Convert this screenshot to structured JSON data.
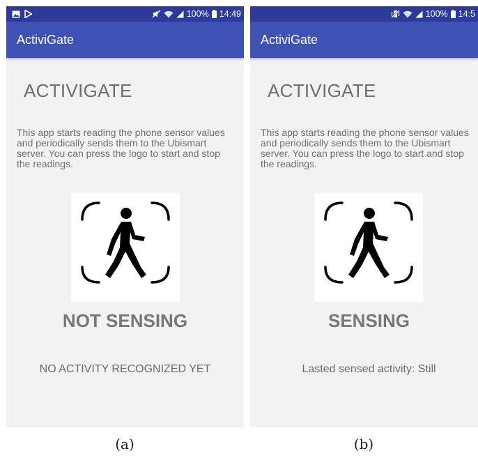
{
  "screens": [
    {
      "status_bar": {
        "left_icons": [
          "image-icon",
          "play-store-icon"
        ],
        "right_icons": [
          "mute-icon",
          "wifi-icon",
          "signal-icon",
          "battery-icon"
        ],
        "battery": "100%",
        "time": "14:49"
      },
      "app_bar": {
        "title": "ActiviGate"
      },
      "heading": "ACTIVIGATE",
      "description": "This app starts reading the phone sensor values and periodically sends them to the Ubismart server. You can press the logo to start and stop the readings.",
      "logo_icon": "walking-person-icon",
      "sensing_status": "NOT SENSING",
      "activity_text": "NO ACTIVITY RECOGNIZED YET"
    },
    {
      "status_bar": {
        "left_icons": [],
        "right_icons": [
          "vibrate-mute-icon",
          "wifi-icon",
          "signal-icon",
          "battery-icon"
        ],
        "battery": "100%",
        "time": "14:5"
      },
      "app_bar": {
        "title": "ActiviGate"
      },
      "heading": "ACTIVIGATE",
      "description": "This app starts reading the phone sensor values and periodically sends them to the Ubismart server. You can press the logo to start and stop the readings.",
      "logo_icon": "walking-person-icon",
      "sensing_status": "SENSING",
      "activity_text": "Lasted sensed activity: Still"
    }
  ],
  "captions": [
    "(a)",
    "(b)"
  ],
  "colors": {
    "status_bar": "#2d3a9a",
    "app_bar": "#3f51b5",
    "background": "#f2f2f2",
    "text_gray": "#6d6d6d"
  }
}
